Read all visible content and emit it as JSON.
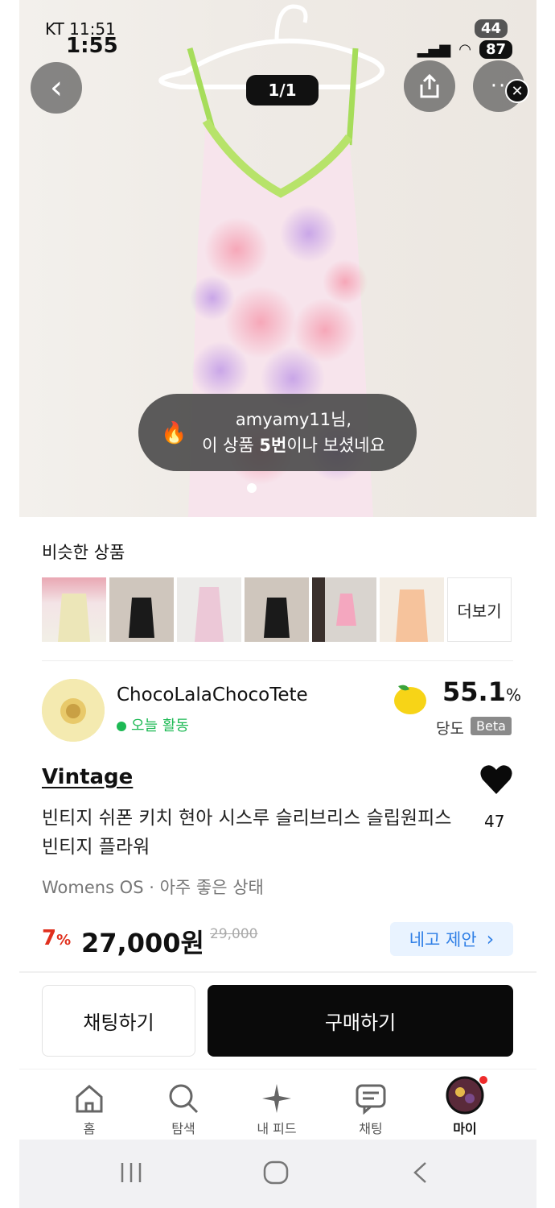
{
  "status_bar": {
    "carrier": "KT 11:51",
    "time": "1:55",
    "battery_top": "44",
    "battery": "87"
  },
  "image_viewer": {
    "counter": "1/1",
    "toast_line1": "amyamy11님,",
    "toast_line2_pre": "이 상품 ",
    "toast_line2_bold": "5번",
    "toast_line2_post": "이나 보셨네요"
  },
  "similar": {
    "title": "비슷한 상품",
    "more_label": "더보기"
  },
  "seller": {
    "name": "ChocoLalaChocoTete",
    "activity": "오늘 활동",
    "score": "55.1",
    "score_unit": "%",
    "score_label": "당도",
    "beta": "Beta"
  },
  "product": {
    "brand": "Vintage",
    "title": "빈티지 쉬폰 키치 현아 시스루 슬리브리스 슬립원피스 빈티지 플라워",
    "like_count": "47",
    "meta": "Womens OS · 아주 좋은 상태",
    "discount": "7",
    "discount_unit": "%",
    "price": "27,000원",
    "original_price": "29,000",
    "offer_label": "네고 제안"
  },
  "actions": {
    "chat_label": "채팅하기",
    "buy_label": "구매하기"
  },
  "tabs": [
    {
      "label": "홈",
      "icon": "home-icon"
    },
    {
      "label": "탐색",
      "icon": "search-icon"
    },
    {
      "label": "내 피드",
      "icon": "sparkle-icon"
    },
    {
      "label": "채팅",
      "icon": "chat-icon"
    },
    {
      "label": "마이",
      "icon": "avatar-icon"
    }
  ],
  "colors": {
    "accent_red": "#e0301e",
    "offer_blue": "#2f7fe6",
    "active_green": "#1db954",
    "lace_green": "#b7e36a"
  }
}
